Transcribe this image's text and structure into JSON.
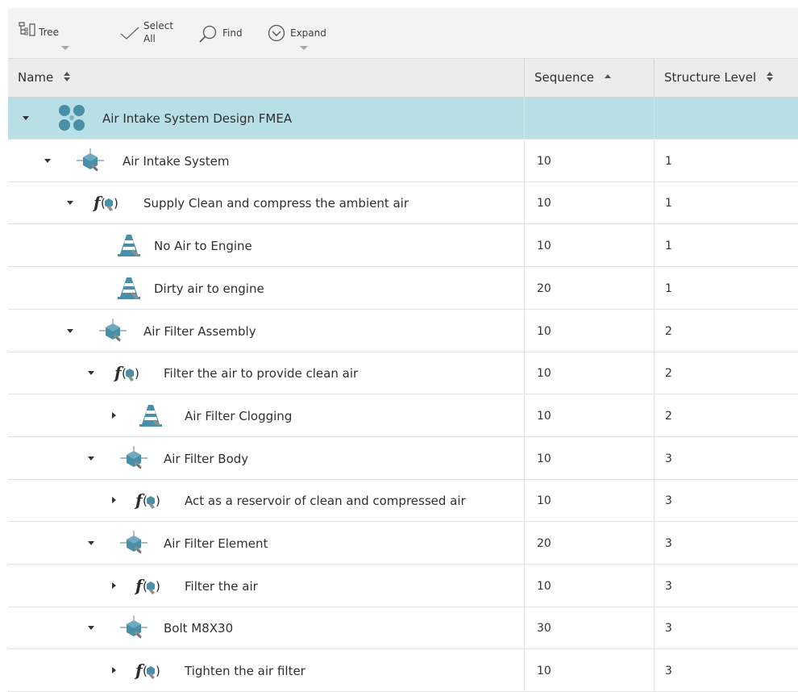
{
  "toolbar": {
    "tree": "Tree",
    "select_all_1": "Select",
    "select_all_2": "All",
    "find": "Find",
    "expand": "Expand"
  },
  "columns": {
    "name": "Name",
    "sequence": "Sequence",
    "structure_level": "Structure Level"
  },
  "rows": [
    {
      "label": "Air Intake System Design FMEA",
      "sequence": "",
      "level": ""
    },
    {
      "label": "Air Intake System",
      "sequence": "10",
      "level": "1"
    },
    {
      "label": "Supply Clean and compress the ambient air",
      "sequence": "10",
      "level": "1"
    },
    {
      "label": "No Air to Engine",
      "sequence": "10",
      "level": "1"
    },
    {
      "label": "Dirty air to engine",
      "sequence": "20",
      "level": "1"
    },
    {
      "label": "Air Filter Assembly",
      "sequence": "10",
      "level": "2"
    },
    {
      "label": "Filter the air to provide clean air",
      "sequence": "10",
      "level": "2"
    },
    {
      "label": "Air Filter Clogging",
      "sequence": "10",
      "level": "2"
    },
    {
      "label": "Air Filter Body",
      "sequence": "10",
      "level": "3"
    },
    {
      "label": "Act as a reservoir of clean and compressed air",
      "sequence": "10",
      "level": "3"
    },
    {
      "label": "Air Filter Element",
      "sequence": "20",
      "level": "3"
    },
    {
      "label": "Filter the air",
      "sequence": "10",
      "level": "3"
    },
    {
      "label": "Bolt M8X30",
      "sequence": "30",
      "level": "3"
    },
    {
      "label": "Tighten the air filter",
      "sequence": "10",
      "level": "3"
    }
  ],
  "icons": {
    "root": "fmea-root-icon",
    "structure": "structure-element-icon",
    "function": "function-icon",
    "failure": "failure-mode-icon"
  },
  "colors": {
    "selected_row": "#b9dfe6",
    "icon_blue": "#4a8fa8"
  }
}
